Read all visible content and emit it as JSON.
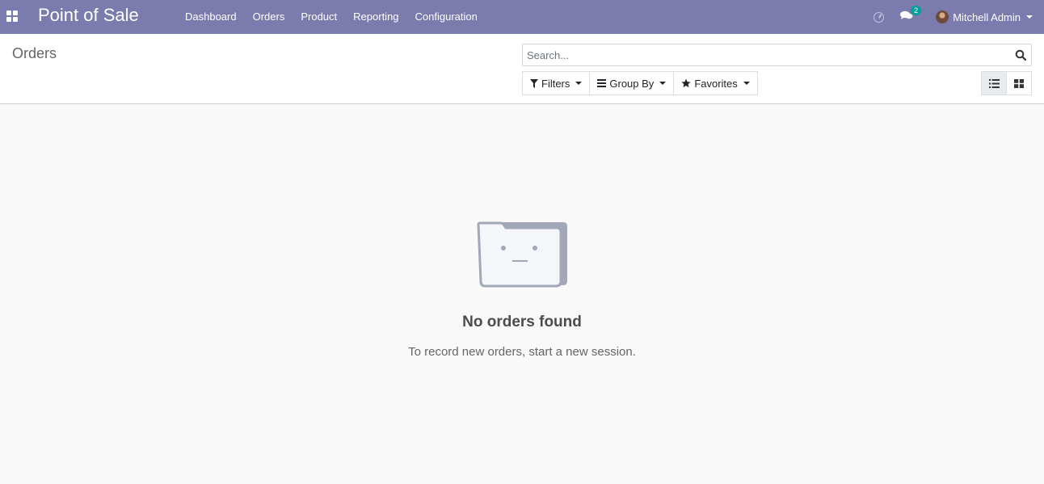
{
  "navbar": {
    "app_name": "Point of Sale",
    "menu": [
      {
        "label": "Dashboard"
      },
      {
        "label": "Orders"
      },
      {
        "label": "Product"
      },
      {
        "label": "Reporting"
      },
      {
        "label": "Configuration"
      }
    ],
    "messages_count": "2",
    "user_name": "Mitchell Admin",
    "bg_color": "#7c7bad"
  },
  "control_panel": {
    "title": "Orders",
    "search": {
      "placeholder": "Search...",
      "value": ""
    },
    "filters_label": "Filters",
    "groupby_label": "Group By",
    "favorites_label": "Favorites",
    "active_view": "list"
  },
  "empty_state": {
    "title": "No orders found",
    "text": "To record new orders, start a new session."
  },
  "icons": [
    "apps-icon",
    "clock-icon",
    "chat-icon",
    "avatar",
    "search-icon",
    "filter-icon",
    "group-by-icon",
    "star-icon",
    "list-view-icon",
    "kanban-view-icon",
    "empty-folder-icon"
  ]
}
